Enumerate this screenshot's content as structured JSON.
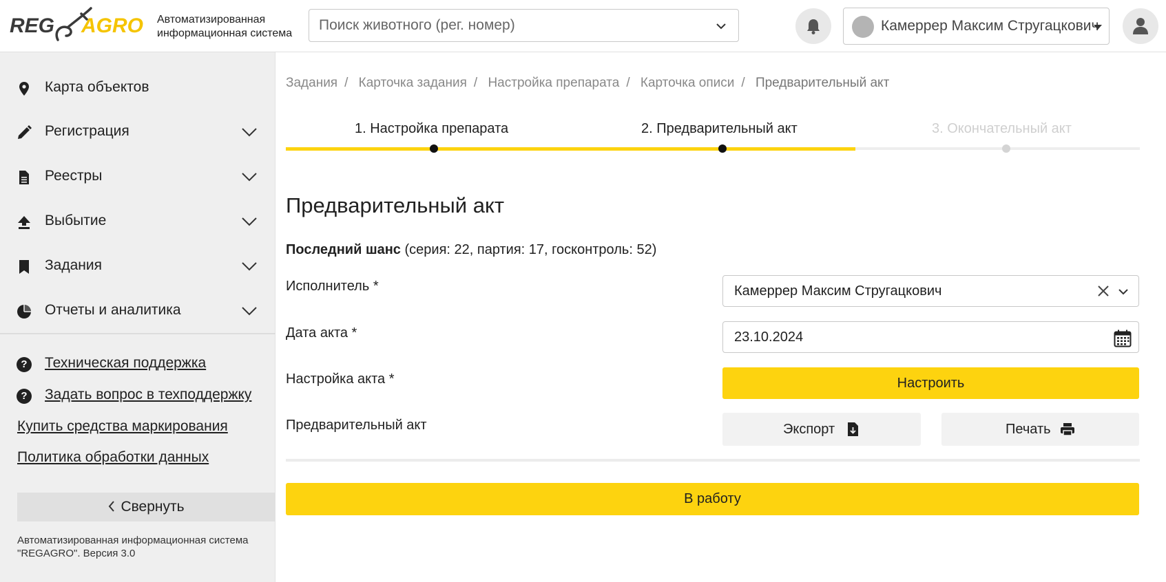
{
  "header": {
    "logo_text_left": "REG",
    "logo_text_right": "AGRO",
    "logo_subtitle_line1": "Автоматизированная",
    "logo_subtitle_line2": "информационная система",
    "search_placeholder": "Поиск животного (рег. номер)",
    "user_name": "Камеррер Максим Стругацкович",
    "accent_color": "#fdd30f"
  },
  "sidebar": {
    "items": [
      {
        "label": "Карта объектов",
        "icon": "map-pin-icon"
      },
      {
        "label": "Регистрация",
        "icon": "pencil-icon"
      },
      {
        "label": "Реестры",
        "icon": "document-icon"
      },
      {
        "label": "Выбытие",
        "icon": "upload-icon"
      },
      {
        "label": "Задания",
        "icon": "bookmark-icon"
      },
      {
        "label": "Отчеты и аналитика",
        "icon": "pie-chart-icon"
      }
    ],
    "links": [
      {
        "label": "Техническая поддержка",
        "icon": "question-icon"
      },
      {
        "label": "Задать вопрос в техподдержку",
        "icon": "question-icon"
      },
      {
        "label": "Купить средства маркирования"
      },
      {
        "label": "Политика обработки данных"
      }
    ],
    "collapse_label": "Свернуть",
    "footer": "Автоматизированная информационная система \"REGAGRO\". Версия 3.0"
  },
  "breadcrumb": [
    "Задания",
    "Карточка задания",
    "Настройка препарата",
    "Карточка описи",
    "Предварительный акт"
  ],
  "steps": {
    "items": [
      "1. Настройка препарата",
      "2. Предварительный акт",
      "3. Окончательный акт"
    ],
    "progress": 0.667
  },
  "main": {
    "title": "Предварительный акт",
    "lot_name": "Последний шанс",
    "lot_details": "(серия: 22, партия: 17, госконтроль: 52)",
    "executor_label": "Исполнитель *",
    "executor_value": "Камеррер Максим Стругацкович",
    "date_label": "Дата акта *",
    "date_value": "23.10.2024",
    "setup_label": "Настройка акта *",
    "setup_button": "Настроить",
    "prelim_label": "Предварительный акт",
    "export_button": "Экспорт",
    "print_button": "Печать",
    "submit_button": "В работу"
  }
}
